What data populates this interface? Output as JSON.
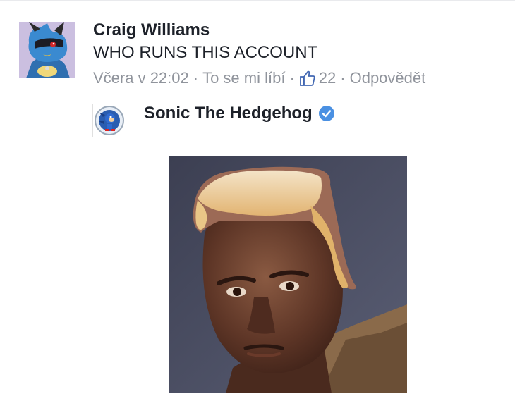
{
  "comment": {
    "author": "Craig Williams",
    "text": "WHO RUNS THIS ACCOUNT",
    "meta": {
      "time": "Včera v 22:02",
      "like_label": "To se mi líbí",
      "like_count": "22",
      "reply_label": "Odpovědět",
      "separator": "·"
    },
    "avatar_icon": "riolu-avatar"
  },
  "reply": {
    "author": "Sonic The Hedgehog",
    "verified_icon": "verified-badge-icon",
    "avatar_icon": "sonic-logo-avatar",
    "image": "meme-photo"
  },
  "colors": {
    "text_primary": "#1d2129",
    "text_meta": "#90949c",
    "like_blue": "#4267b2",
    "verified_blue": "#4a90e2"
  }
}
